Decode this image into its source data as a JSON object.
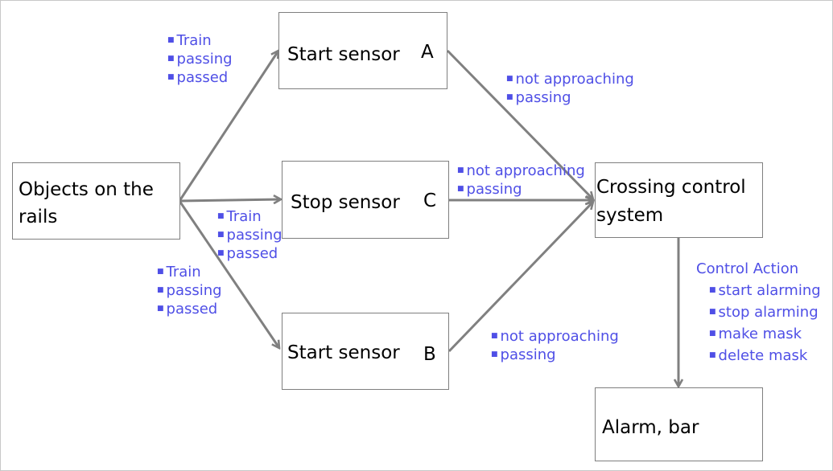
{
  "nodes": {
    "objects": {
      "line1": "Objects on the",
      "line2": "rails"
    },
    "start_a": {
      "label": "Start sensor",
      "tag": "A"
    },
    "stop_c": {
      "label": "Stop sensor",
      "tag": "C"
    },
    "start_b": {
      "label": "Start sensor",
      "tag": "B"
    },
    "crossing": {
      "line1": "Crossing control",
      "line2": "system"
    },
    "alarm": {
      "label": "Alarm, bar"
    }
  },
  "edge_labels": {
    "to_start_a": [
      "Train",
      "passing",
      "passed"
    ],
    "to_stop_c": [
      "Train",
      "passing",
      "passed"
    ],
    "to_start_b": [
      "Train",
      "passing",
      "passed"
    ],
    "from_start_a": [
      "not approaching",
      "passing"
    ],
    "from_stop_c": [
      "not approaching",
      "passing"
    ],
    "from_start_b": [
      "not approaching",
      "passing"
    ],
    "control_action": {
      "title": "Control Action",
      "items": [
        "start alarming",
        "stop alarming",
        "make mask",
        "delete mask"
      ]
    }
  },
  "colors": {
    "label": "#4f4fe6",
    "arrow": "#808080",
    "border": "#7f7f7f"
  }
}
